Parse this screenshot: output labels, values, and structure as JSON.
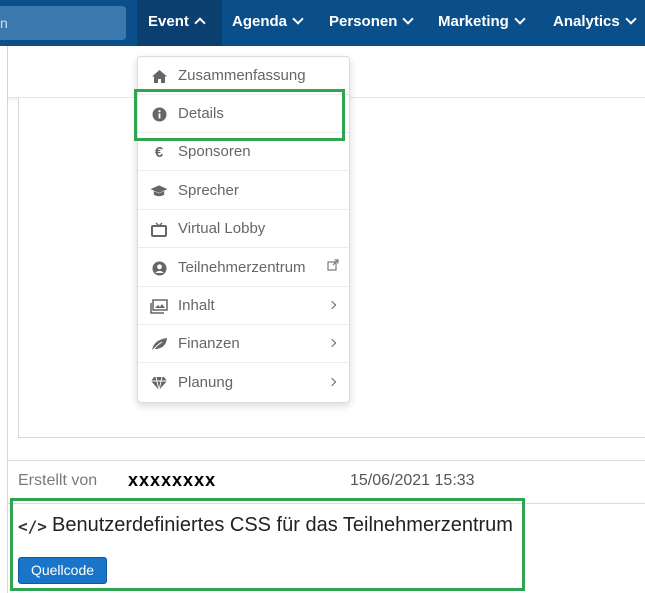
{
  "nav": {
    "search_text": "n",
    "items": [
      {
        "label": "Event"
      },
      {
        "label": "Agenda"
      },
      {
        "label": "Personen"
      },
      {
        "label": "Marketing"
      },
      {
        "label": "Analytics"
      }
    ],
    "active": "Event"
  },
  "dropdown": {
    "items": [
      {
        "label": "Zusammenfassung",
        "icon": "home-icon"
      },
      {
        "label": "Details",
        "icon": "info-circle-icon"
      },
      {
        "label": "Sponsoren",
        "icon": "euro-icon"
      },
      {
        "label": "Sprecher",
        "icon": "graduation-cap-icon"
      },
      {
        "label": "Virtual Lobby",
        "icon": "tv-icon"
      },
      {
        "label": "Teilnehmerzentrum",
        "icon": "user-circle-icon",
        "trailing": "external-link-icon"
      },
      {
        "label": "Inhalt",
        "icon": "images-icon",
        "trailing": "chevron-right-icon"
      },
      {
        "label": "Finanzen",
        "icon": "leaf-icon",
        "trailing": "chevron-right-icon"
      },
      {
        "label": "Planung",
        "icon": "diamond-icon",
        "trailing": "chevron-right-icon"
      }
    ]
  },
  "meta": {
    "created_label": "Erstellt von",
    "created_name": "xxxxxxxx",
    "created_date": "15/06/2021 15:33"
  },
  "custom_css": {
    "icon": "</>",
    "title": "Benutzerdefiniertes CSS für das Teilnehmerzentrum",
    "button": "Quellcode"
  },
  "colors": {
    "nav_bg": "#0b4f8a",
    "nav_active": "#0a3f70",
    "highlight": "#2fa552",
    "button": "#1a75c9"
  }
}
